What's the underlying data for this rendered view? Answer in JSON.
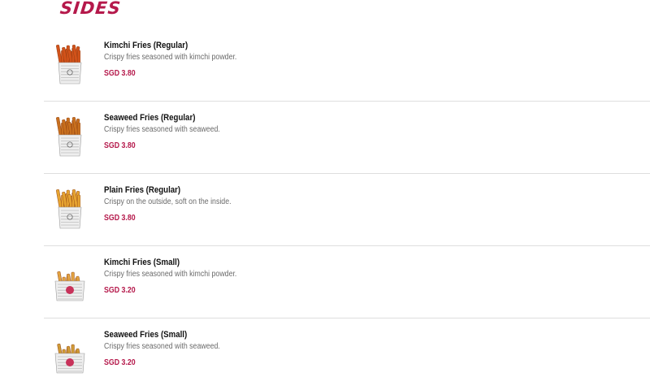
{
  "section": {
    "title": "SIDES"
  },
  "items": [
    {
      "name": "Kimchi Fries (Regular)",
      "description": "Crispy fries seasoned with kimchi powder.",
      "price": "SGD 3.80",
      "thumb_icon": "kimchi-fries-icon",
      "size": "regular",
      "fries_color": "#d2521a"
    },
    {
      "name": "Seaweed Fries (Regular)",
      "description": "Crispy fries seasoned with seaweed.",
      "price": "SGD 3.80",
      "thumb_icon": "seaweed-fries-icon",
      "size": "regular",
      "fries_color": "#c8701e"
    },
    {
      "name": "Plain Fries (Regular)",
      "description": "Crispy on the outside, soft on the inside.",
      "price": "SGD 3.80",
      "thumb_icon": "plain-fries-icon",
      "size": "regular",
      "fries_color": "#e6a431"
    },
    {
      "name": "Kimchi Fries (Small)",
      "description": "Crispy fries seasoned with kimchi powder.",
      "price": "SGD 3.20",
      "thumb_icon": "kimchi-fries-small-icon",
      "size": "small",
      "fries_color": "#e2a240"
    },
    {
      "name": "Seaweed Fries (Small)",
      "description": "Crispy fries seasoned with seaweed.",
      "price": "SGD 3.20",
      "thumb_icon": "seaweed-fries-small-icon",
      "size": "small",
      "fries_color": "#cf9a35"
    }
  ],
  "colors": {
    "accent": "#b5194b",
    "divider": "#dedede"
  }
}
